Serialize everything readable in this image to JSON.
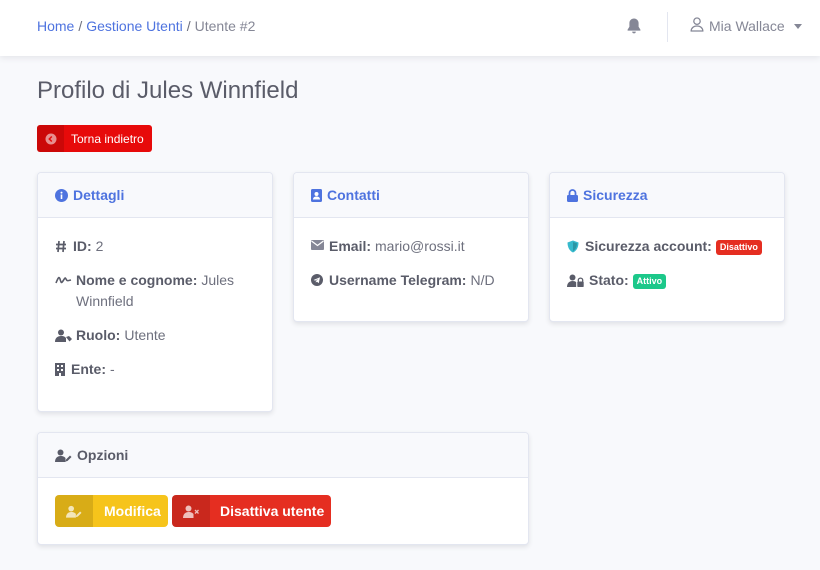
{
  "breadcrumb": {
    "home": "Home",
    "users": "Gestione Utenti",
    "current": "Utente #2",
    "sep": "/"
  },
  "user_menu": {
    "name": "Mia Wallace"
  },
  "page": {
    "title": "Profilo di Jules Winnfield",
    "back_label": "Torna indietro"
  },
  "details": {
    "title": "Dettagli",
    "id_label": "ID:",
    "id_value": "2",
    "name_label": "Nome e cognome:",
    "name_value": "Jules Winnfield",
    "role_label": "Ruolo:",
    "role_value": "Utente",
    "ente_label": "Ente:",
    "ente_value": "-"
  },
  "contacts": {
    "title": "Contatti",
    "email_label": "Email:",
    "email_value": "mario@rossi.it",
    "telegram_label": "Username Telegram:",
    "telegram_value": "N/D"
  },
  "security": {
    "title": "Sicurezza",
    "account_label": "Sicurezza account:",
    "account_badge": "Disattivo",
    "state_label": "Stato:",
    "state_badge": "Attivo"
  },
  "options": {
    "title": "Opzioni",
    "edit_label": "Modifica",
    "disable_label": "Disattiva utente"
  },
  "colors": {
    "primary": "#4e73df",
    "danger": "#e52e21",
    "warning": "#f6c41b",
    "success": "#1cc88a",
    "info": "#36b9cc"
  },
  "icons": [
    "bell-icon",
    "user-icon",
    "arrow-left-circle-icon",
    "info-circle-icon",
    "address-card-icon",
    "lock-icon",
    "hashtag-icon",
    "signature-icon",
    "user-tag-icon",
    "building-icon",
    "envelope-icon",
    "telegram-icon",
    "shield-icon",
    "user-lock-icon",
    "user-edit-icon",
    "user-times-icon"
  ]
}
